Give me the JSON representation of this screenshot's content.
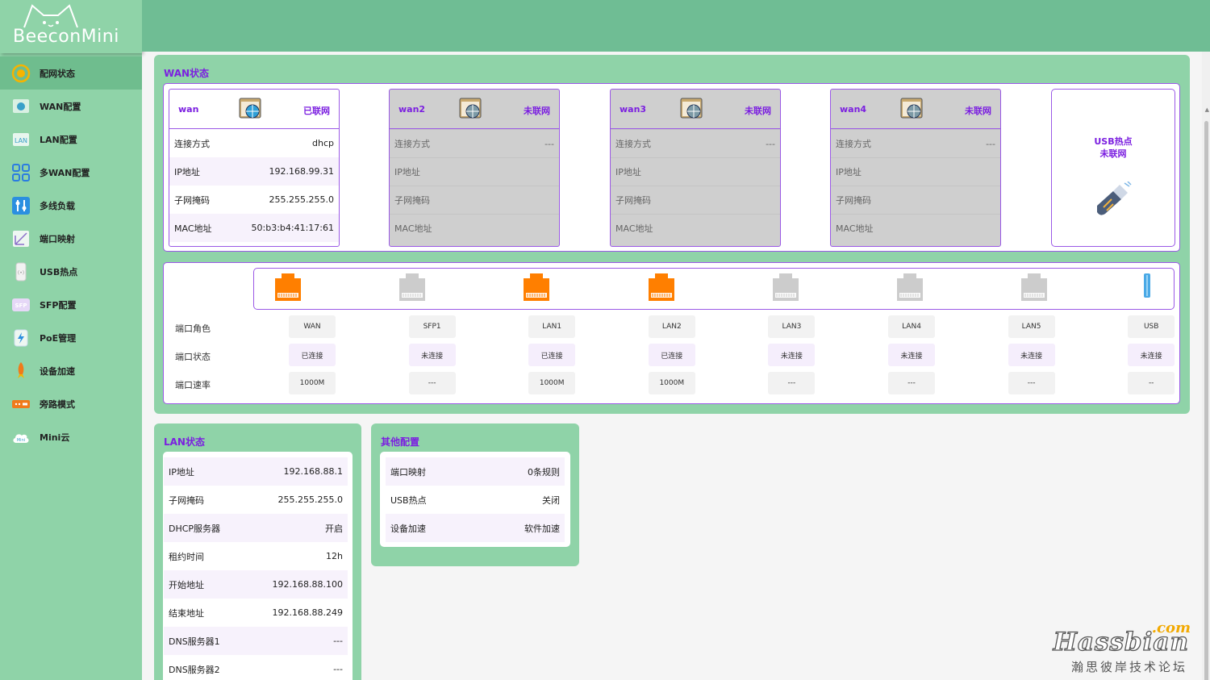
{
  "brand": {
    "name": "BeeconMini"
  },
  "colors": {
    "accent": "#7b1fe0",
    "sidebar": "#8fd3a8",
    "topbar": "#6fbd94",
    "port_active": "#ff7f00",
    "port_inactive": "#cccccc"
  },
  "sidebar": {
    "items": [
      {
        "label": "配网状态",
        "icon": "dashboard-icon",
        "active": true
      },
      {
        "label": "WAN配置",
        "icon": "wan-globe-icon"
      },
      {
        "label": "LAN配置",
        "icon": "lan-icon"
      },
      {
        "label": "多WAN配置",
        "icon": "multi-wan-icon"
      },
      {
        "label": "多线负载",
        "icon": "load-balance-icon"
      },
      {
        "label": "端口映射",
        "icon": "port-mapping-icon"
      },
      {
        "label": "USB热点",
        "icon": "usb-hotspot-icon"
      },
      {
        "label": "SFP配置",
        "icon": "sfp-icon"
      },
      {
        "label": "PoE管理",
        "icon": "poe-icon"
      },
      {
        "label": "设备加速",
        "icon": "rocket-icon"
      },
      {
        "label": "旁路模式",
        "icon": "bypass-icon"
      },
      {
        "label": "Mini云",
        "icon": "cloud-icon"
      }
    ]
  },
  "wan_status": {
    "title": "WAN状态",
    "cards": [
      {
        "name": "wan",
        "state": "已联网",
        "connected": true,
        "rows": [
          {
            "k": "连接方式",
            "v": "dhcp"
          },
          {
            "k": "IP地址",
            "v": "192.168.99.31"
          },
          {
            "k": "子网掩码",
            "v": "255.255.255.0"
          },
          {
            "k": "MAC地址",
            "v": "50:b3:b4:41:17:61"
          }
        ]
      },
      {
        "name": "wan2",
        "state": "未联网",
        "connected": false,
        "rows": [
          {
            "k": "连接方式",
            "v": "---"
          },
          {
            "k": "IP地址",
            "v": ""
          },
          {
            "k": "子网掩码",
            "v": ""
          },
          {
            "k": "MAC地址",
            "v": ""
          }
        ]
      },
      {
        "name": "wan3",
        "state": "未联网",
        "connected": false,
        "rows": [
          {
            "k": "连接方式",
            "v": "---"
          },
          {
            "k": "IP地址",
            "v": ""
          },
          {
            "k": "子网掩码",
            "v": ""
          },
          {
            "k": "MAC地址",
            "v": ""
          }
        ]
      },
      {
        "name": "wan4",
        "state": "未联网",
        "connected": false,
        "rows": [
          {
            "k": "连接方式",
            "v": "---"
          },
          {
            "k": "IP地址",
            "v": ""
          },
          {
            "k": "子网掩码",
            "v": ""
          },
          {
            "k": "MAC地址",
            "v": ""
          }
        ]
      }
    ],
    "usb": {
      "line1": "USB热点",
      "line2": "未联网"
    }
  },
  "ports": {
    "row_labels": {
      "role": "端口角色",
      "status": "端口状态",
      "speed": "端口速率"
    },
    "list": [
      {
        "role": "WAN",
        "status": "已连接",
        "speed": "1000M",
        "active": true
      },
      {
        "role": "SFP1",
        "status": "未连接",
        "speed": "---",
        "active": false
      },
      {
        "role": "LAN1",
        "status": "已连接",
        "speed": "1000M",
        "active": true
      },
      {
        "role": "LAN2",
        "status": "已连接",
        "speed": "1000M",
        "active": true
      },
      {
        "role": "LAN3",
        "status": "未连接",
        "speed": "---",
        "active": false
      },
      {
        "role": "LAN4",
        "status": "未连接",
        "speed": "---",
        "active": false
      },
      {
        "role": "LAN5",
        "status": "未连接",
        "speed": "---",
        "active": false
      },
      {
        "role": "USB",
        "status": "未连接",
        "speed": "--",
        "active": false
      }
    ]
  },
  "lan_status": {
    "title": "LAN状态",
    "rows": [
      {
        "k": "IP地址",
        "v": "192.168.88.1"
      },
      {
        "k": "子网掩码",
        "v": "255.255.255.0"
      },
      {
        "k": "DHCP服务器",
        "v": "开启"
      },
      {
        "k": "租约时间",
        "v": "12h"
      },
      {
        "k": "开始地址",
        "v": "192.168.88.100"
      },
      {
        "k": "结束地址",
        "v": "192.168.88.249"
      },
      {
        "k": "DNS服务器1",
        "v": "---"
      },
      {
        "k": "DNS服务器2",
        "v": "---"
      }
    ]
  },
  "other_config": {
    "title": "其他配置",
    "rows": [
      {
        "k": "端口映射",
        "v": "0条规则"
      },
      {
        "k": "USB热点",
        "v": "关闭"
      },
      {
        "k": "设备加速",
        "v": "软件加速"
      }
    ]
  },
  "watermark": {
    "suffix": ".com",
    "main": "Hassbian",
    "sub": "瀚思彼岸技术论坛"
  }
}
